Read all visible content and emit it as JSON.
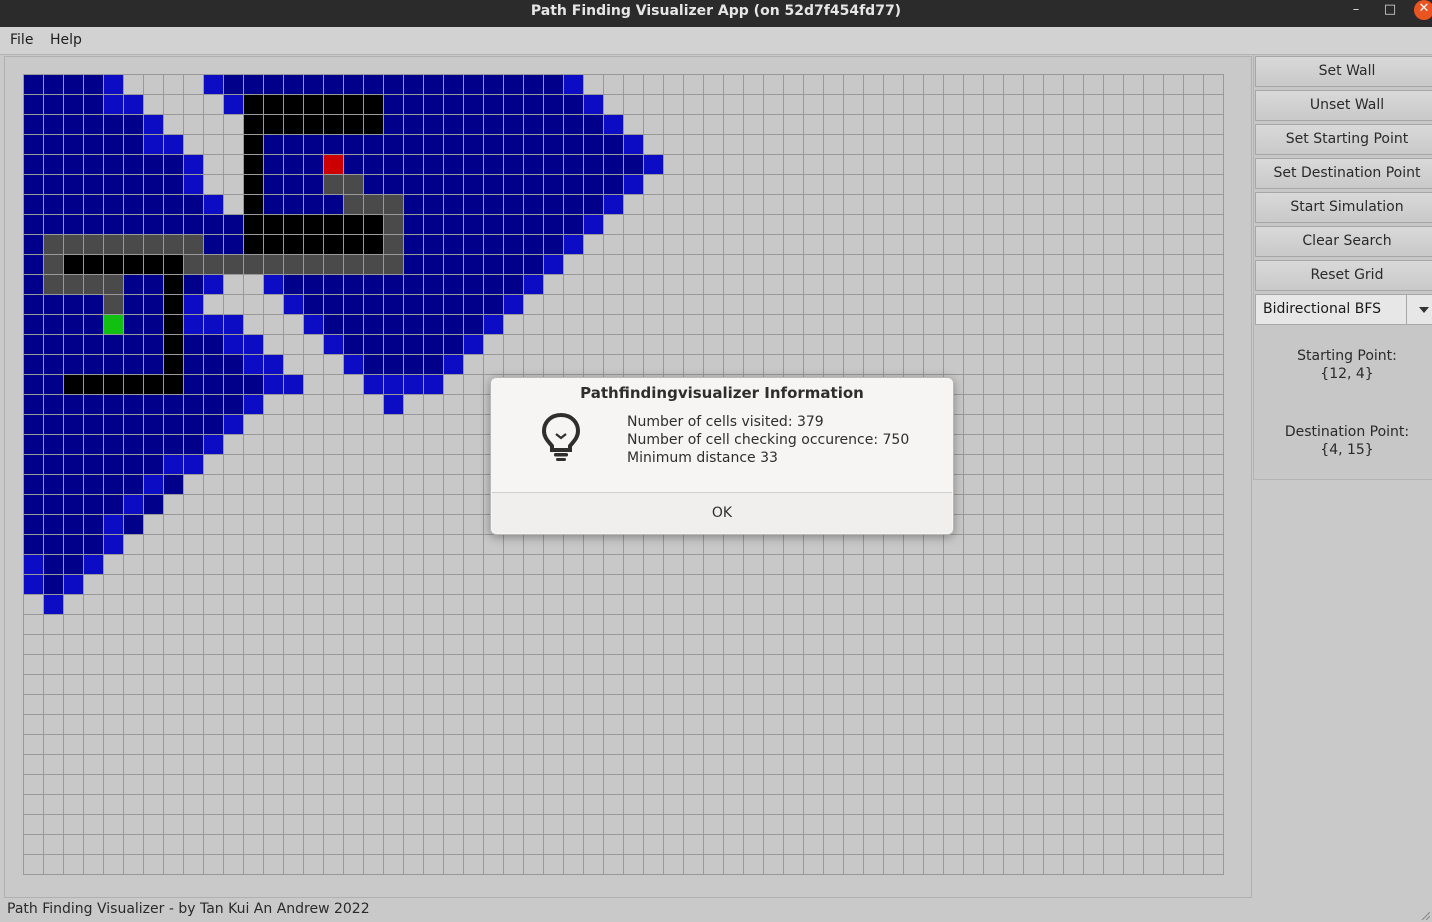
{
  "window": {
    "title": "Path Finding Visualizer App (on 52d7f454fd77)",
    "minimize_glyph": "–",
    "maximize_glyph": "□",
    "close_glyph": "✕",
    "close_color": "#e95420"
  },
  "menubar": {
    "items": [
      "File",
      "Help"
    ]
  },
  "grid": {
    "cols": 60,
    "rows": 40,
    "colors": {
      "empty": "#c8c8c8",
      "visited": "#00008a",
      "frontier": "#0c0cc4",
      "wall": "#000000",
      "path": "#4a4a4a",
      "start": "#cc0000",
      "destination": "#12c012",
      "gridline": "#999999"
    },
    "visited_rows": [
      [
        0,
        [
          [
            0,
            4
          ],
          [
            9,
            27
          ]
        ]
      ],
      [
        1,
        [
          [
            0,
            5
          ],
          [
            10,
            28
          ]
        ]
      ],
      [
        2,
        [
          [
            0,
            6
          ],
          [
            11,
            29
          ]
        ]
      ],
      [
        3,
        [
          [
            0,
            7
          ],
          [
            11,
            30
          ]
        ]
      ],
      [
        4,
        [
          [
            0,
            8
          ],
          [
            11,
            31
          ]
        ]
      ],
      [
        5,
        [
          [
            0,
            8
          ],
          [
            11,
            30
          ]
        ]
      ],
      [
        6,
        [
          [
            0,
            9
          ],
          [
            11,
            29
          ]
        ]
      ],
      [
        7,
        [
          [
            0,
            28
          ]
        ]
      ],
      [
        8,
        [
          [
            0,
            27
          ]
        ]
      ],
      [
        9,
        [
          [
            0,
            26
          ]
        ]
      ],
      [
        10,
        [
          [
            0,
            9
          ],
          [
            12,
            25
          ]
        ]
      ],
      [
        11,
        [
          [
            0,
            8
          ],
          [
            13,
            24
          ]
        ]
      ],
      [
        12,
        [
          [
            0,
            10
          ],
          [
            14,
            23
          ]
        ]
      ],
      [
        13,
        [
          [
            0,
            11
          ],
          [
            15,
            22
          ]
        ]
      ],
      [
        14,
        [
          [
            0,
            12
          ],
          [
            16,
            21
          ]
        ]
      ],
      [
        15,
        [
          [
            0,
            13
          ],
          [
            17,
            20
          ]
        ]
      ],
      [
        16,
        [
          [
            0,
            11
          ],
          [
            18,
            18
          ]
        ]
      ],
      [
        17,
        [
          [
            0,
            10
          ]
        ]
      ],
      [
        18,
        [
          [
            0,
            9
          ]
        ]
      ],
      [
        19,
        [
          [
            0,
            8
          ]
        ]
      ],
      [
        20,
        [
          [
            0,
            7
          ]
        ]
      ],
      [
        21,
        [
          [
            0,
            6
          ]
        ]
      ],
      [
        22,
        [
          [
            0,
            5
          ]
        ]
      ],
      [
        23,
        [
          [
            0,
            4
          ]
        ]
      ],
      [
        24,
        [
          [
            0,
            3
          ]
        ]
      ],
      [
        25,
        [
          [
            0,
            2
          ]
        ]
      ],
      [
        26,
        [
          [
            1,
            1
          ]
        ]
      ]
    ],
    "frontier_cells": [
      [
        0,
        4
      ],
      [
        0,
        9
      ],
      [
        0,
        27
      ],
      [
        1,
        4
      ],
      [
        1,
        5
      ],
      [
        1,
        10
      ],
      [
        1,
        28
      ],
      [
        2,
        6
      ],
      [
        2,
        29
      ],
      [
        3,
        6
      ],
      [
        3,
        7
      ],
      [
        3,
        30
      ],
      [
        4,
        8
      ],
      [
        4,
        31
      ],
      [
        5,
        8
      ],
      [
        5,
        30
      ],
      [
        6,
        9
      ],
      [
        6,
        29
      ],
      [
        7,
        28
      ],
      [
        8,
        27
      ],
      [
        9,
        26
      ],
      [
        10,
        9
      ],
      [
        10,
        12
      ],
      [
        10,
        25
      ],
      [
        11,
        8
      ],
      [
        11,
        13
      ],
      [
        11,
        24
      ],
      [
        12,
        8
      ],
      [
        12,
        9
      ],
      [
        12,
        10
      ],
      [
        12,
        14
      ],
      [
        12,
        23
      ],
      [
        13,
        10
      ],
      [
        13,
        11
      ],
      [
        13,
        15
      ],
      [
        13,
        22
      ],
      [
        14,
        11
      ],
      [
        14,
        12
      ],
      [
        14,
        16
      ],
      [
        14,
        21
      ],
      [
        15,
        12
      ],
      [
        15,
        13
      ],
      [
        15,
        17
      ],
      [
        15,
        18
      ],
      [
        15,
        19
      ],
      [
        15,
        20
      ],
      [
        16,
        11
      ],
      [
        16,
        18
      ],
      [
        17,
        10
      ],
      [
        18,
        9
      ],
      [
        19,
        7
      ],
      [
        19,
        8
      ],
      [
        20,
        6
      ],
      [
        21,
        5
      ],
      [
        22,
        4
      ],
      [
        23,
        4
      ],
      [
        24,
        0
      ],
      [
        24,
        3
      ],
      [
        25,
        0
      ],
      [
        25,
        2
      ],
      [
        26,
        1
      ]
    ],
    "wall_cells": [
      [
        1,
        11
      ],
      [
        1,
        12
      ],
      [
        1,
        13
      ],
      [
        1,
        14
      ],
      [
        1,
        15
      ],
      [
        1,
        16
      ],
      [
        1,
        17
      ],
      [
        2,
        11
      ],
      [
        2,
        12
      ],
      [
        2,
        13
      ],
      [
        2,
        14
      ],
      [
        2,
        15
      ],
      [
        2,
        16
      ],
      [
        2,
        17
      ],
      [
        3,
        11
      ],
      [
        4,
        11
      ],
      [
        5,
        11
      ],
      [
        6,
        11
      ],
      [
        7,
        11
      ],
      [
        7,
        12
      ],
      [
        7,
        13
      ],
      [
        7,
        14
      ],
      [
        7,
        15
      ],
      [
        7,
        16
      ],
      [
        7,
        17
      ],
      [
        8,
        11
      ],
      [
        8,
        12
      ],
      [
        8,
        13
      ],
      [
        8,
        14
      ],
      [
        8,
        15
      ],
      [
        8,
        16
      ],
      [
        8,
        17
      ],
      [
        9,
        2
      ],
      [
        9,
        3
      ],
      [
        9,
        4
      ],
      [
        9,
        5
      ],
      [
        9,
        6
      ],
      [
        9,
        7
      ],
      [
        10,
        7
      ],
      [
        11,
        7
      ],
      [
        12,
        7
      ],
      [
        13,
        7
      ],
      [
        14,
        7
      ],
      [
        15,
        2
      ],
      [
        15,
        3
      ],
      [
        15,
        4
      ],
      [
        15,
        5
      ],
      [
        15,
        6
      ],
      [
        15,
        7
      ]
    ],
    "path_cells": [
      [
        5,
        15
      ],
      [
        5,
        16
      ],
      [
        6,
        16
      ],
      [
        6,
        17
      ],
      [
        6,
        18
      ],
      [
        7,
        18
      ],
      [
        8,
        18
      ],
      [
        8,
        1
      ],
      [
        8,
        2
      ],
      [
        8,
        3
      ],
      [
        8,
        4
      ],
      [
        8,
        5
      ],
      [
        8,
        6
      ],
      [
        8,
        7
      ],
      [
        8,
        8
      ],
      [
        9,
        1
      ],
      [
        9,
        8
      ],
      [
        9,
        9
      ],
      [
        9,
        10
      ],
      [
        9,
        11
      ],
      [
        9,
        12
      ],
      [
        9,
        13
      ],
      [
        9,
        14
      ],
      [
        9,
        15
      ],
      [
        9,
        16
      ],
      [
        9,
        17
      ],
      [
        9,
        18
      ],
      [
        10,
        1
      ],
      [
        10,
        2
      ],
      [
        10,
        3
      ],
      [
        10,
        4
      ],
      [
        11,
        4
      ]
    ],
    "start_cell": [
      4,
      15
    ],
    "destination_cell": [
      12,
      4
    ]
  },
  "sidebar": {
    "buttons": [
      "Set Wall",
      "Unset Wall",
      "Set Starting Point",
      "Set Destination Point",
      "Start Simulation",
      "Clear Search",
      "Reset Grid"
    ],
    "algorithm_selected": "Bidirectional BFS",
    "starting_point_label": "Starting Point:",
    "starting_point_value": "{12, 4}",
    "destination_point_label": "Destination Point:",
    "destination_point_value": "{4, 15}"
  },
  "dialog": {
    "title": "Pathfindingvisualizer Information",
    "icon": "lightbulb-icon",
    "lines": [
      "Number of cells visited: 379",
      "Number of cell checking occurence: 750",
      "Minimum distance 33"
    ],
    "ok_label": "OK"
  },
  "statusbar": {
    "text": "Path Finding Visualizer - by Tan Kui An Andrew 2022"
  }
}
